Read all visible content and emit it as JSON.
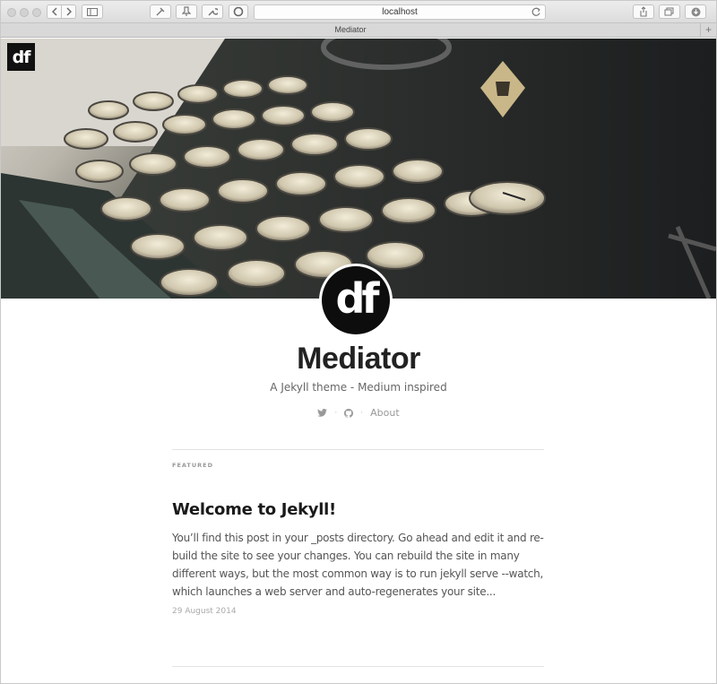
{
  "browser": {
    "url": "localhost",
    "tab_title": "Mediator",
    "new_tab_label": "+"
  },
  "icons": {
    "back": "chevron-left-icon",
    "forward": "chevron-right-icon",
    "sidebar": "sidebar-icon",
    "extension": "extension-icon",
    "pin": "pin-icon",
    "wrench": "wrench-icon",
    "opera": "o-extension-icon",
    "reload": "reload-icon",
    "share": "share-icon",
    "tabs": "tabs-overview-icon",
    "download": "download-icon",
    "twitter": "twitter-icon",
    "github": "github-icon"
  },
  "site": {
    "logo_text": "df",
    "title": "Mediator",
    "description": "A Jekyll theme - Medium inspired",
    "about_label": "About",
    "separator": "·"
  },
  "featured": {
    "label": "FEATURED"
  },
  "post": {
    "title": "Welcome to Jekyll!",
    "excerpt": "You’ll find this post in your _posts directory. Go ahead and edit it and re-build the site to see your changes. You can rebuild the site in many different ways, but the most common way is to run jekyll serve --watch, which launches a web server and auto-regenerates your site...",
    "date": "29 August 2014"
  },
  "colors": {
    "title": "#222222",
    "muted": "#999999",
    "logo_bg": "#111111"
  }
}
